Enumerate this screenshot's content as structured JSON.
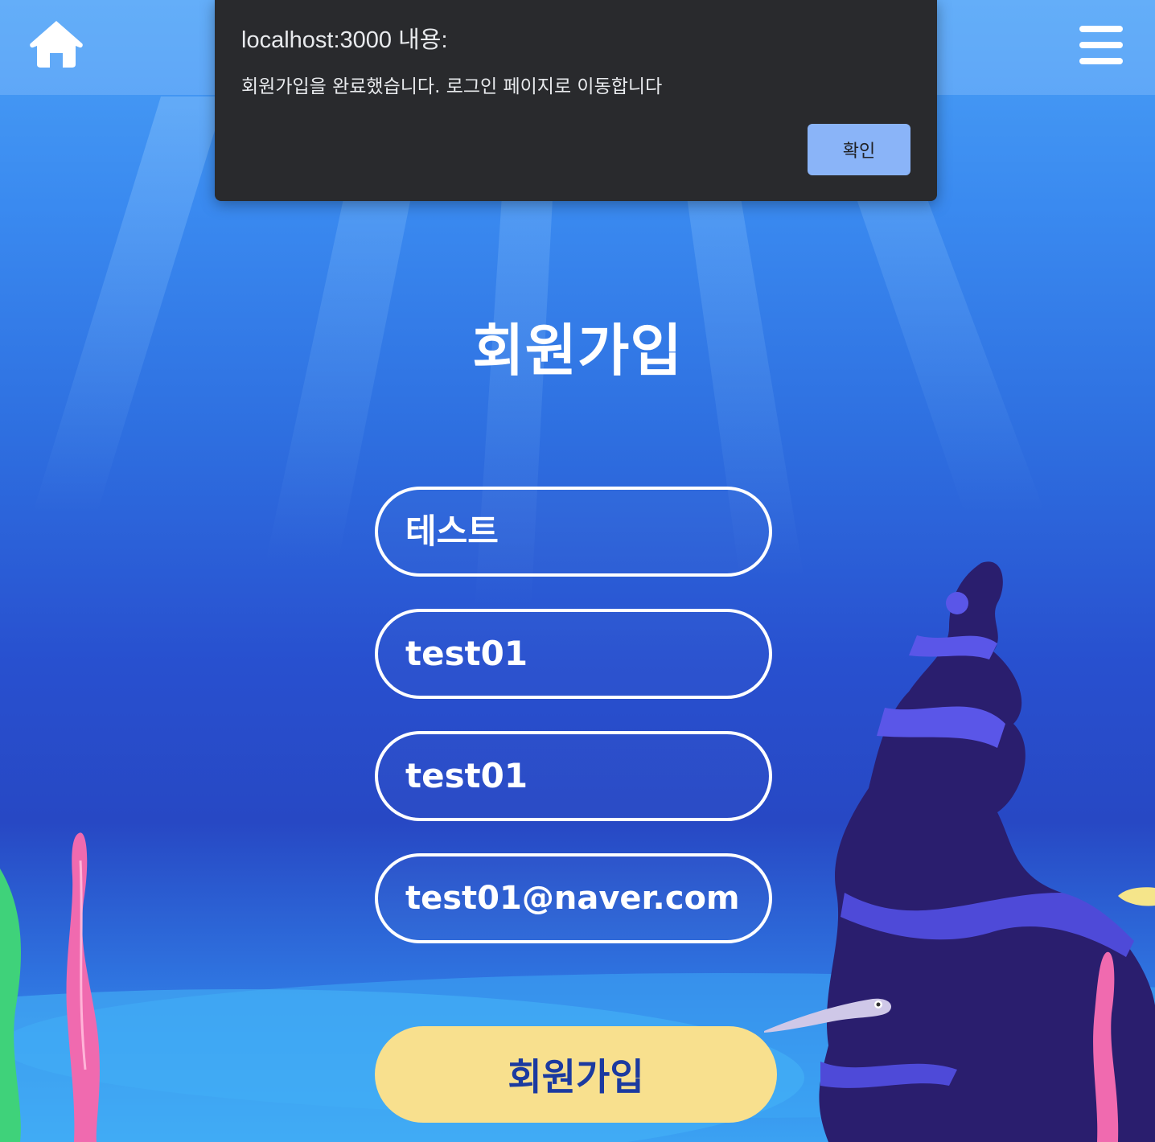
{
  "dialog": {
    "title": "localhost:3000 내용:",
    "message": "회원가입을 완료했습니다. 로그인 페이지로 이동합니다",
    "ok_label": "확인"
  },
  "page": {
    "title": "회원가입"
  },
  "form": {
    "name_value": "테스트",
    "id_value": "test01",
    "password_value": "test01",
    "email_value": "test01@naver.com",
    "submit_label": "회원가입"
  },
  "icons": {
    "home": "home-icon",
    "menu": "hamburger-menu-icon"
  },
  "colors": {
    "dialog_bg": "#292a2d",
    "dialog_button": "#8ab4f8",
    "submit_button": "#f8e08e",
    "submit_text": "#1b3aa0"
  }
}
